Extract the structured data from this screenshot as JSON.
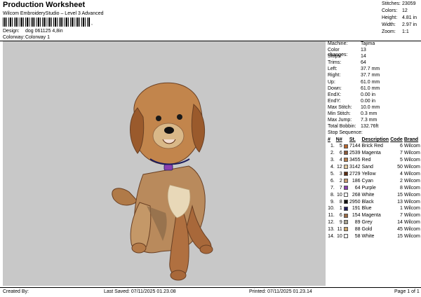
{
  "header": {
    "title": "Production Worksheet",
    "subtitle": "Wilcom EmbroideryStudio – Level 3 Advanced",
    "barcode_mark": ",",
    "design_label": "Design:",
    "design_value": "dog 061125 4,8in",
    "colorway_label": "Colorway:",
    "colorway_value": "Colorway 1"
  },
  "stats": [
    {
      "label": "Stitches:",
      "value": "23059"
    },
    {
      "label": "Colors:",
      "value": "12"
    },
    {
      "label": "Height:",
      "value": "4.81 in"
    },
    {
      "label": "Width:",
      "value": "2.97 in"
    },
    {
      "label": "Zoom:",
      "value": "1:1"
    }
  ],
  "machine": [
    {
      "label": "Machine:",
      "value": "Tajima"
    },
    {
      "label": "Color changes:",
      "value": "13"
    },
    {
      "label": "Stops:",
      "value": "14"
    },
    {
      "label": "Trims:",
      "value": "64"
    },
    {
      "label": "Left:",
      "value": "37.7 mm"
    },
    {
      "label": "Right:",
      "value": "37.7 mm"
    },
    {
      "label": "Up:",
      "value": "61.0 mm"
    },
    {
      "label": "Down:",
      "value": "61.0 mm"
    },
    {
      "label": "EndX:",
      "value": "0.00 in"
    },
    {
      "label": "EndY:",
      "value": "0.00 in"
    },
    {
      "label": "Max Stitch:",
      "value": "10.0 mm"
    },
    {
      "label": "Min Stitch:",
      "value": "0.3 mm"
    },
    {
      "label": "Max Jump:",
      "value": "7.3 mm"
    },
    {
      "label": "Total Bobbin:",
      "value": "132.76ft"
    }
  ],
  "sequence": {
    "title": "Stop Sequence:",
    "headers": [
      "#",
      "N#",
      "St.",
      "Description",
      "Code",
      "Brand"
    ],
    "rows": [
      {
        "num": "1.",
        "n": "5",
        "color": "#b8652c",
        "st": "7144",
        "desc": "Brick Red",
        "code": "6",
        "brand": "Wilcom"
      },
      {
        "num": "2.",
        "n": "6",
        "color": "#8a5a3a",
        "st": "2539",
        "desc": "Magenta",
        "code": "7",
        "brand": "Wilcom"
      },
      {
        "num": "3.",
        "n": "4",
        "color": "#b77d4a",
        "st": "3455",
        "desc": "Red",
        "code": "5",
        "brand": "Wilcom"
      },
      {
        "num": "4.",
        "n": "12",
        "color": "#e2c9a0",
        "st": "3142",
        "desc": "Sand",
        "code": "50",
        "brand": "Wilcom"
      },
      {
        "num": "5.",
        "n": "3",
        "color": "#5a2c12",
        "st": "2729",
        "desc": "Yellow",
        "code": "4",
        "brand": "Wilcom"
      },
      {
        "num": "6.",
        "n": "2",
        "color": "#c89a72",
        "st": "186",
        "desc": "Cyan",
        "code": "2",
        "brand": "Wilcom"
      },
      {
        "num": "7.",
        "n": "7",
        "color": "#8a3fb0",
        "st": "64",
        "desc": "Purple",
        "code": "8",
        "brand": "Wilcom"
      },
      {
        "num": "8.",
        "n": "10",
        "color": "#ffffff",
        "st": "268",
        "desc": "White",
        "code": "15",
        "brand": "Wilcom"
      },
      {
        "num": "9.",
        "n": "8",
        "color": "#111111",
        "st": "2950",
        "desc": "Black",
        "code": "13",
        "brand": "Wilcom"
      },
      {
        "num": "10.",
        "n": "1",
        "color": "#1c1c5c",
        "st": "191",
        "desc": "Blue",
        "code": "1",
        "brand": "Wilcom"
      },
      {
        "num": "11.",
        "n": "6",
        "color": "#9b6a44",
        "st": "154",
        "desc": "Magenta",
        "code": "7",
        "brand": "Wilcom"
      },
      {
        "num": "12.",
        "n": "9",
        "color": "#a8a290",
        "st": "89",
        "desc": "Grey",
        "code": "14",
        "brand": "Wilcom"
      },
      {
        "num": "13.",
        "n": "11",
        "color": "#c9a56a",
        "st": "88",
        "desc": "Gold",
        "code": "45",
        "brand": "Wilcom"
      },
      {
        "num": "14.",
        "n": "10",
        "color": "#ffffff",
        "st": "58",
        "desc": "White",
        "code": "15",
        "brand": "Wilcom"
      }
    ]
  },
  "footer": {
    "created_by": "Created By:",
    "last_saved": "Last Saved: 07/11/2025 01.23.08",
    "printed": "Printed: 07/11/2025 01.23.14",
    "page": "Page 1 of 1"
  }
}
